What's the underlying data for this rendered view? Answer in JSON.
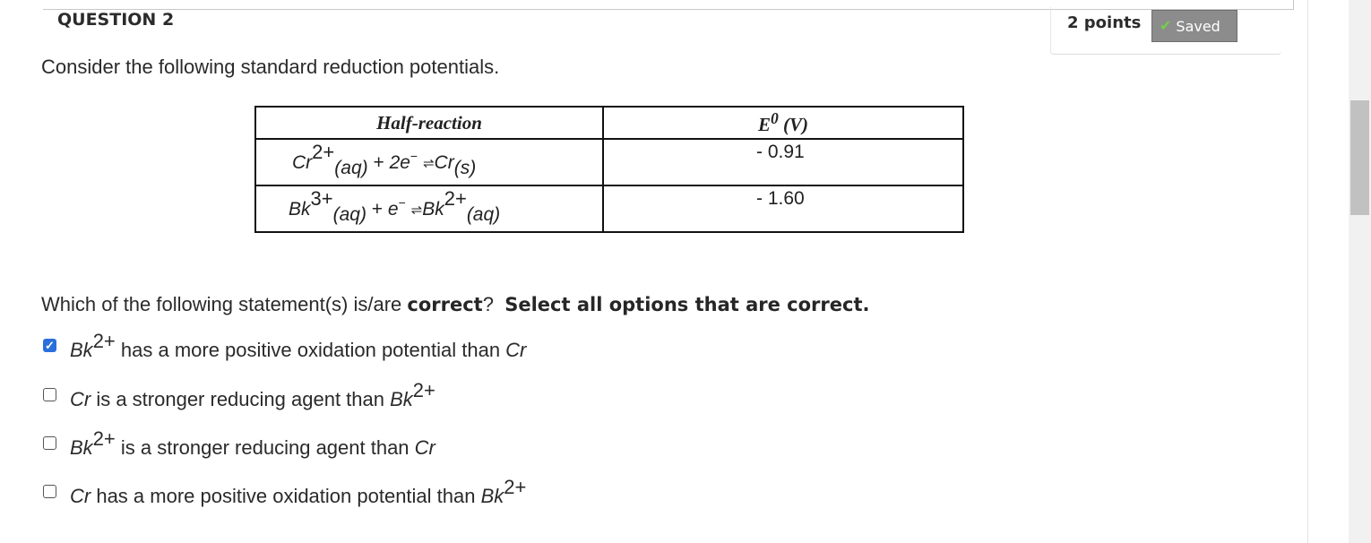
{
  "question": {
    "title": "QUESTION 2",
    "points": "2 points",
    "saved_label": "Saved",
    "intro": "Consider the following standard reduction potentials.",
    "prompt_start": "Which of the following statement(s) is/are",
    "prompt_bold": "correct",
    "prompt_q": "?",
    "prompt_instruction": "Select all options that are correct."
  },
  "table": {
    "headers": [
      "Half-reaction",
      "E",
      "0",
      " (V)"
    ],
    "rows": [
      {
        "species1": "Cr",
        "charge1": "2+",
        "state1": "(aq)",
        "plus": " + ",
        "electrons": "2e",
        "eminus": "−",
        "equilibrium": "⇌",
        "product": "Cr",
        "state2": "(s)",
        "value": "- 0.91"
      },
      {
        "species1": "Bk",
        "charge1": "3+",
        "state1": "(aq)",
        "plus": " + ",
        "electrons": "e",
        "eminus": "−",
        "equilibrium": "⇌",
        "product": "Bk",
        "charge2": "2+",
        "state2": "(aq)",
        "value": "- 1.60"
      }
    ]
  },
  "options": [
    {
      "checked": true,
      "a": "Bk",
      "a_sup": "2+",
      "mid": " has a more positive oxidation potential than ",
      "b": "Cr",
      "b_sup": ""
    },
    {
      "checked": false,
      "a": "Cr",
      "a_sup": "",
      "mid": " is a stronger reducing agent than ",
      "b": "Bk",
      "b_sup": "2+"
    },
    {
      "checked": false,
      "a": "Bk",
      "a_sup": "2+",
      "mid": " is a stronger reducing agent than ",
      "b": "Cr",
      "b_sup": ""
    },
    {
      "checked": false,
      "a": "Cr",
      "a_sup": "",
      "mid": " has a more positive oxidation potential than ",
      "b": "Bk",
      "b_sup": "2+"
    }
  ],
  "icons": {
    "saved": "checkmark-icon",
    "checkbox_checked": "checkbox-checked-icon",
    "checkbox_empty": "checkbox-empty-icon"
  },
  "colors": {
    "saved_bg": "#8c8c8c",
    "check_green": "#74d04a",
    "checkbox_blue": "#2a6fdb"
  }
}
